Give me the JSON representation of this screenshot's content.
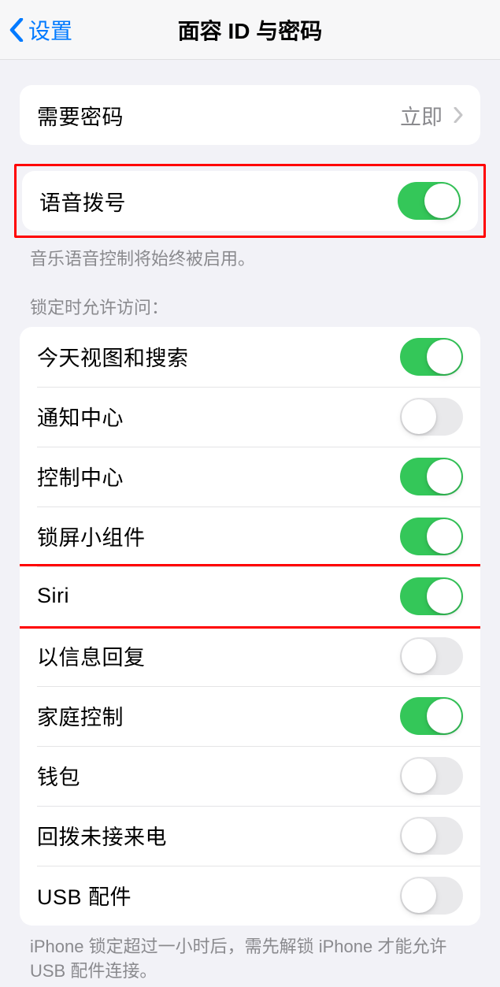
{
  "nav": {
    "back_label": "设置",
    "title": "面容 ID 与密码"
  },
  "require_passcode": {
    "label": "需要密码",
    "value": "立即"
  },
  "voice_dial": {
    "label": "语音拨号",
    "on": true,
    "footer": "音乐语音控制将始终被启用。"
  },
  "access_header": "锁定时允许访问：",
  "access_items": [
    {
      "label": "今天视图和搜索",
      "on": true
    },
    {
      "label": "通知中心",
      "on": false
    },
    {
      "label": "控制中心",
      "on": true
    },
    {
      "label": "锁屏小组件",
      "on": true
    },
    {
      "label": "Siri",
      "on": true,
      "highlight": true
    },
    {
      "label": "以信息回复",
      "on": false
    },
    {
      "label": "家庭控制",
      "on": true
    },
    {
      "label": "钱包",
      "on": false
    },
    {
      "label": "回拨未接来电",
      "on": false
    },
    {
      "label": "USB 配件",
      "on": false
    }
  ],
  "access_footer": "iPhone 锁定超过一小时后，需先解锁 iPhone 才能允许 USB 配件连接。"
}
